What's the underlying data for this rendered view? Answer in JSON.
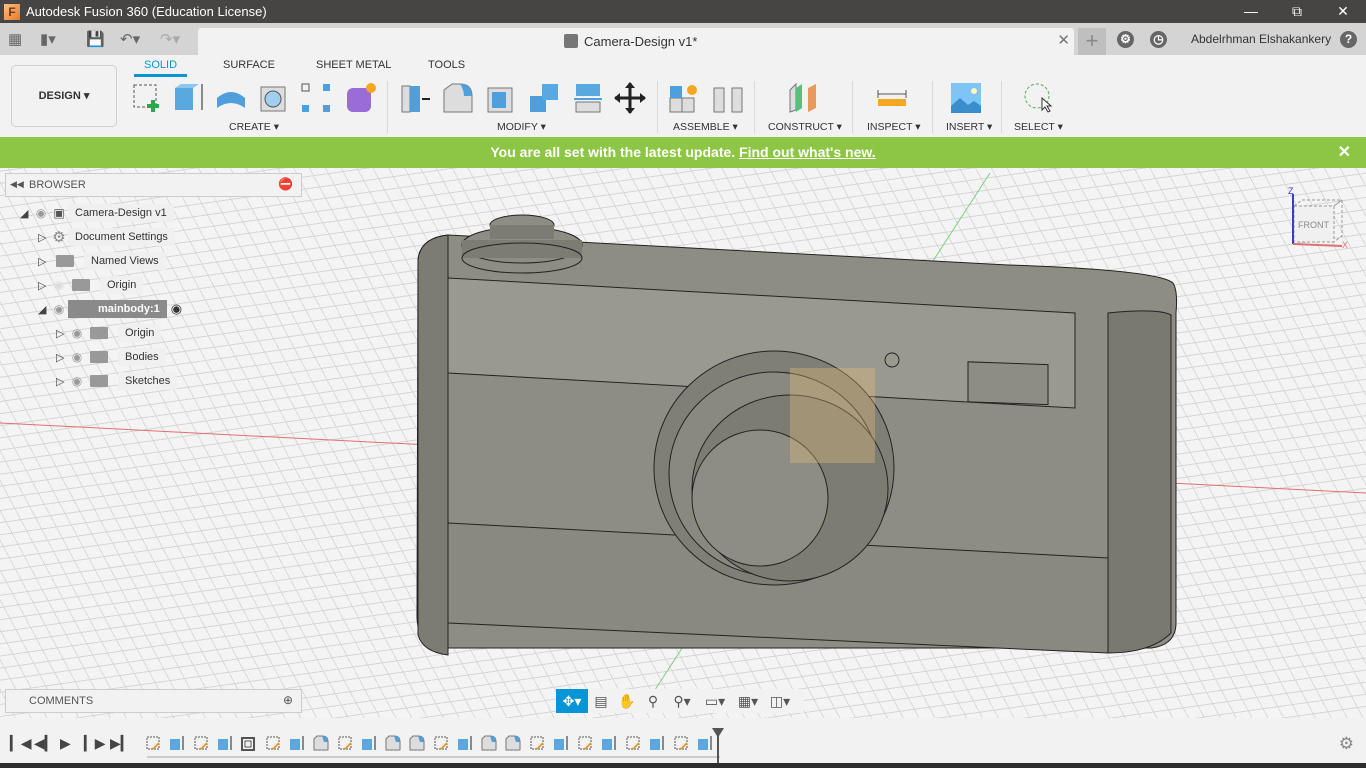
{
  "window": {
    "title": "Autodesk Fusion 360 (Education License)",
    "controls": [
      "minimize",
      "restore",
      "close"
    ]
  },
  "quick_access": {
    "doc_tab_title": "Camera-Design v1*",
    "user_name": "Abdelrhman Elshakankery"
  },
  "workspace": {
    "label": "DESIGN"
  },
  "ribbon": {
    "tabs": [
      {
        "label": "SOLID",
        "active": true
      },
      {
        "label": "SURFACE"
      },
      {
        "label": "SHEET METAL"
      },
      {
        "label": "TOOLS"
      }
    ],
    "groups": [
      {
        "label": "CREATE",
        "tools": [
          "create-sketch",
          "extrude",
          "revolve",
          "hole",
          "pattern",
          "create-form"
        ]
      },
      {
        "label": "MODIFY",
        "tools": [
          "press-pull",
          "fillet",
          "shell",
          "combine",
          "split-body",
          "move"
        ]
      },
      {
        "label": "ASSEMBLE",
        "tools": [
          "new-component",
          "joint"
        ]
      },
      {
        "label": "CONSTRUCT",
        "tools": [
          "offset-plane"
        ]
      },
      {
        "label": "INSPECT",
        "tools": [
          "measure"
        ]
      },
      {
        "label": "INSERT",
        "tools": [
          "insert-image"
        ]
      },
      {
        "label": "SELECT",
        "tools": [
          "select"
        ]
      }
    ]
  },
  "banner": {
    "text": "You are all set with the latest update.",
    "link": "Find out what's new.",
    "color": "#8dc645"
  },
  "browser": {
    "title": "BROWSER",
    "items": [
      {
        "label": "Camera-Design v1",
        "level": 0,
        "expanded": true
      },
      {
        "label": "Document Settings",
        "level": 1
      },
      {
        "label": "Named Views",
        "level": 1
      },
      {
        "label": "Origin",
        "level": 1,
        "hidden": true
      },
      {
        "label": "mainbody:1",
        "level": 1,
        "expanded": true,
        "active": true
      },
      {
        "label": "Origin",
        "level": 2
      },
      {
        "label": "Bodies",
        "level": 2
      },
      {
        "label": "Sketches",
        "level": 2
      }
    ]
  },
  "viewcube": {
    "face": "FRONT",
    "axis_z": "Z",
    "axis_x": "X"
  },
  "comments": {
    "title": "COMMENTS"
  },
  "navbar": {
    "tools": [
      "orbit",
      "look-at",
      "pan",
      "zoom",
      "fit",
      "display-settings",
      "grid-settings",
      "viewports"
    ]
  },
  "timeline": {
    "controls": [
      "first",
      "previous",
      "play",
      "next",
      "last"
    ],
    "features": [
      "sketch",
      "extrude",
      "sketch",
      "extrude",
      "shell",
      "sketch",
      "extrude",
      "fillet",
      "sketch",
      "extrude",
      "fillet",
      "fillet",
      "sketch",
      "extrude",
      "fillet",
      "fillet",
      "sketch",
      "extrude",
      "sketch",
      "extrude",
      "sketch",
      "extrude",
      "sketch",
      "extrude"
    ]
  }
}
